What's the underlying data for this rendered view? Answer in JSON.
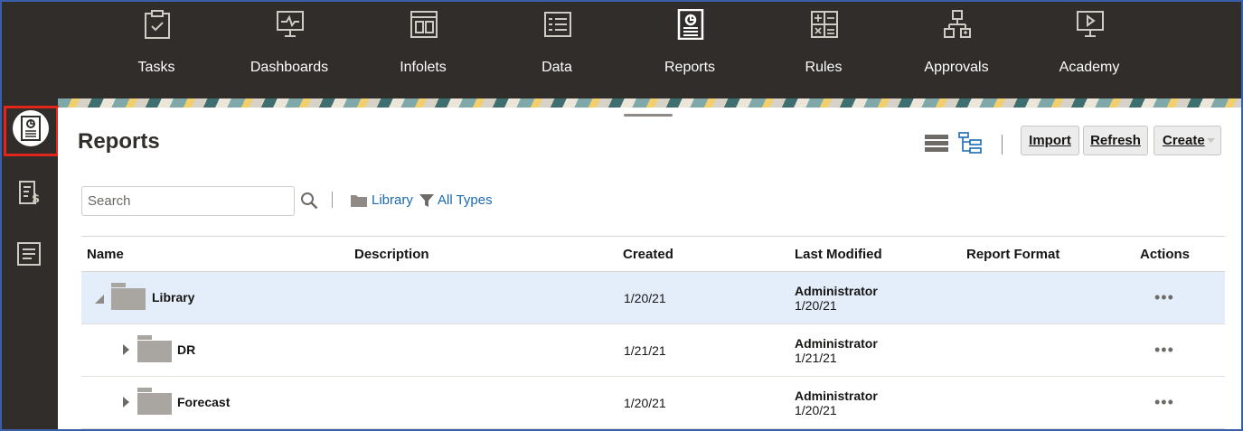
{
  "nav": {
    "items": [
      {
        "label": "Tasks",
        "icon": "tasks-clipboard-icon"
      },
      {
        "label": "Dashboards",
        "icon": "dashboard-monitor-icon"
      },
      {
        "label": "Infolets",
        "icon": "infolets-icon"
      },
      {
        "label": "Data",
        "icon": "data-grid-icon"
      },
      {
        "label": "Reports",
        "icon": "reports-icon"
      },
      {
        "label": "Rules",
        "icon": "rules-calculator-icon"
      },
      {
        "label": "Approvals",
        "icon": "approvals-hierarchy-icon"
      },
      {
        "label": "Academy",
        "icon": "academy-video-icon"
      }
    ],
    "active": "Reports"
  },
  "rail": {
    "items": [
      {
        "icon": "reports-icon",
        "active": true
      },
      {
        "icon": "financial-report-icon",
        "active": false
      },
      {
        "icon": "document-icon",
        "active": false
      }
    ]
  },
  "page": {
    "title": "Reports"
  },
  "toolbar": {
    "import_label": "Import",
    "refresh_label": "Refresh",
    "create_label": "Create"
  },
  "search": {
    "placeholder": "Search"
  },
  "filters": {
    "library_label": "Library",
    "types_label": "All Types"
  },
  "table": {
    "columns": [
      "Name",
      "Description",
      "Created",
      "Last Modified",
      "Report Format",
      "Actions"
    ],
    "rows": [
      {
        "name": "Library",
        "description": "",
        "created": "1/20/21",
        "modified_by": "Administrator",
        "modified_on": "1/20/21",
        "format": "",
        "expanded": true
      },
      {
        "name": "DR",
        "description": "",
        "created": "1/21/21",
        "modified_by": "Administrator",
        "modified_on": "1/21/21",
        "format": "",
        "expanded": false
      },
      {
        "name": "Forecast",
        "description": "",
        "created": "1/20/21",
        "modified_by": "Administrator",
        "modified_on": "1/20/21",
        "format": "",
        "expanded": false
      }
    ],
    "actions_glyph": "•••"
  },
  "colors": {
    "nav_bg": "#312d2a",
    "accent_link": "#1a6ab2",
    "selected_row": "#e4eefb",
    "highlight_border": "#e0251b"
  }
}
